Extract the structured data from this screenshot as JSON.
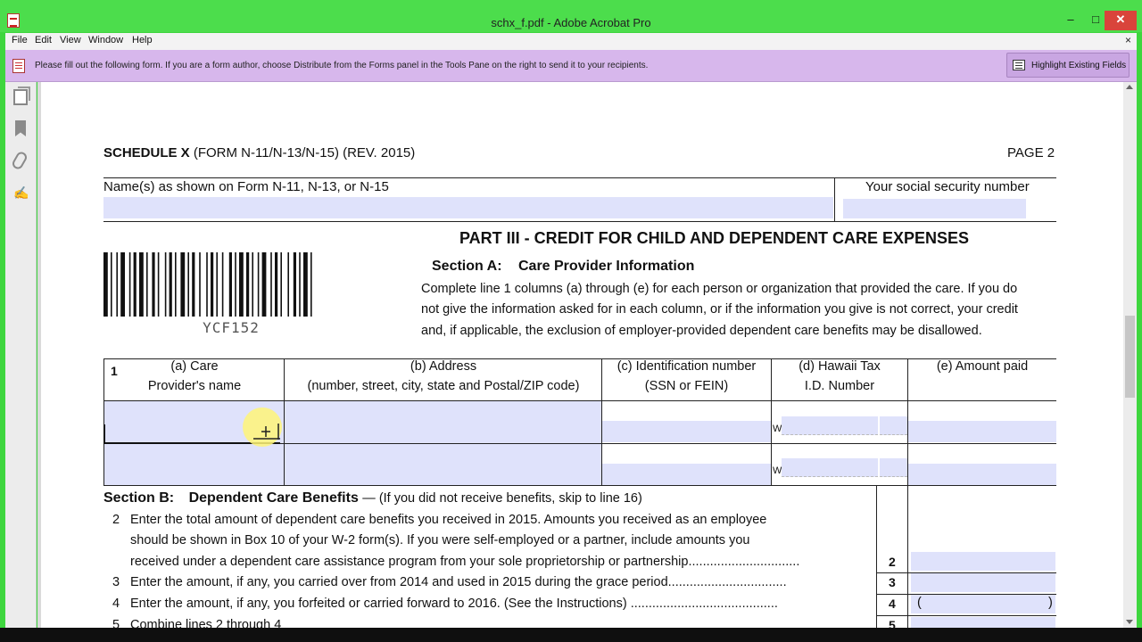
{
  "window": {
    "title": "schx_f.pdf - Adobe Acrobat Pro",
    "min": "–",
    "max": "□",
    "close": "✕"
  },
  "menu": {
    "items": [
      "File",
      "Edit",
      "View",
      "Window",
      "Help"
    ],
    "doc_close": "×"
  },
  "form_bar": {
    "message": "Please fill out the following form. If you are a form author, choose Distribute from the Forms panel in the Tools Pane on the right to send it to your recipients.",
    "highlight_button": "Highlight Existing Fields"
  },
  "document": {
    "schedule_label": "SCHEDULE X",
    "schedule_form": "(FORM N-11/N-13/N-15) (REV. 2015)",
    "page_label": "PAGE 2",
    "names_label": "Name(s) as shown on Form N-11, N-13, or N-15",
    "ssn_label": "Your social security number",
    "barcode_text": "YCF152",
    "part_title": "PART III - CREDIT FOR CHILD AND DEPENDENT CARE EXPENSES",
    "section_a_label": "Section A:",
    "section_a_title": "Care Provider Information",
    "section_a_lines": [
      "Complete line 1 columns (a) through (e) for each person or organization that provided the care. If you do",
      "not give the information asked for in each column, or if the information you give is not correct, your credit",
      "and, if applicable, the exclusion of employer-provided dependent care benefits may be disallowed."
    ],
    "line_number": "1",
    "columns": [
      {
        "line1": "(a) Care",
        "line2": "Provider's name"
      },
      {
        "line1": "(b) Address",
        "line2": "(number, street, city, state and Postal/ZIP code)"
      },
      {
        "line1": "(c) Identification number",
        "line2": "(SSN or FEIN)"
      },
      {
        "line1": "(d) Hawaii Tax",
        "line2": "I.D. Number"
      },
      {
        "line1": "(e) Amount paid",
        "line2": ""
      }
    ],
    "w_prefix": "W",
    "section_b_label": "Section B:",
    "section_b_title": "Dependent Care Benefits",
    "section_b_note": "— (If you did not receive benefits, skip to line 16)",
    "lines": [
      {
        "num": "2",
        "text": [
          "Enter the total amount of dependent care benefits you received in 2015.  Amounts you received as an employee",
          "should be shown in Box 10 of your W-2 form(s). If you were self-employed or a partner, include amounts you",
          "received under a dependent care assistance program from your sole proprietorship or partnership."
        ],
        "dots": "..............................",
        "box": "2"
      },
      {
        "num": "3",
        "text": [
          "Enter the amount, if any, you carried over from 2014 and used in 2015 during the grace period"
        ],
        "dots": ".................................",
        "box": "3"
      },
      {
        "num": "4",
        "text": [
          "Enter the amount, if any, you forfeited or carried forward to 2016.  (See the Instructions)"
        ],
        "dots": ".........................................",
        "box": "4",
        "open_paren": "(",
        "close_paren": ")"
      },
      {
        "num": "5",
        "text": [
          "Combine lines 2 through 4"
        ],
        "dots": "",
        "box": "5"
      }
    ]
  },
  "colors": {
    "titlebar": "#4cdd4c",
    "formbar": "#d7b7ec",
    "field": "#dfe2fb",
    "close": "#d9443b"
  }
}
